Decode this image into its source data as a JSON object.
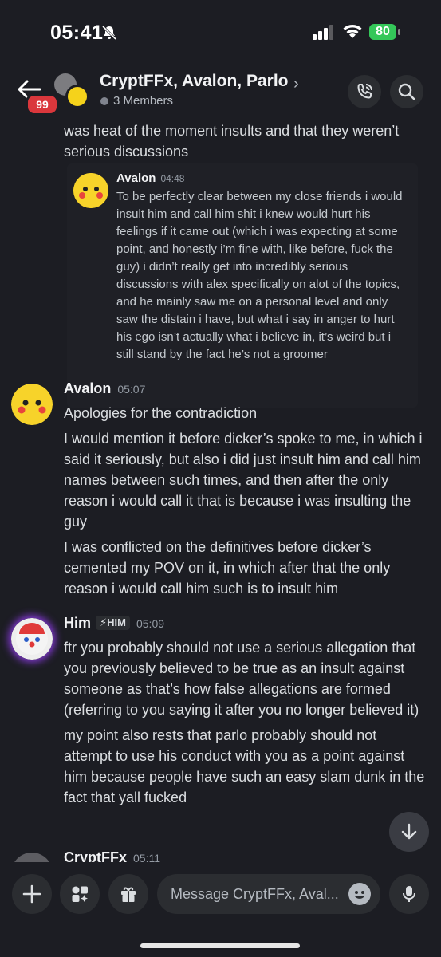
{
  "status": {
    "time": "05:41",
    "battery": "80"
  },
  "header": {
    "unread_badge": "99",
    "title": "CryptFFx, Avalon, Parlo",
    "members": "3 Members",
    "title_chevron": "›"
  },
  "continued": {
    "text": "was heat of the moment insults and that they weren’t serious discussions",
    "quote": {
      "author": "Avalon",
      "time": "04:48",
      "text": "To be perfectly clear between my close friends i would insult him and call him shit i knew would hurt his feelings if it came out (which i was expecting at some point, and honestly i’m fine with, like before, fuck the guy) i didn’t really get into incredibly serious discussions with alex specifically on alot of the topics, and he mainly saw me on a personal level and only saw the distain i have, but what i say in anger to hurt his ego isn’t actually what i believe in, it’s weird but i still stand by the fact he’s not a groomer"
    }
  },
  "messages": [
    {
      "author": "Avalon",
      "time": "05:07",
      "paragraphs": [
        "Apologies for the contradiction",
        "I would mention it before dicker’s spoke to me, in which i said it seriously, but also i did just insult him and call him names between such times, and then after the only reason i would call it that is because i was insulting the guy",
        "I was conflicted on the definitives before dicker’s cemented my POV on it, in which after that the only reason i would call him such is to insult him"
      ]
    },
    {
      "author": "Him",
      "tag": "⚡HIM",
      "time": "05:09",
      "paragraphs": [
        "ftr you probably should not use a serious allegation that you previously believed to be true as an insult against someone as that’s how false allegations are formed (referring to you saying it after you no longer believed it)",
        "my point also rests that parlo probably should not attempt to use his conduct with you as a point against him because people have such an easy slam dunk in the fact that yall fucked"
      ]
    },
    {
      "author": "CryptFFx",
      "time": "05:11"
    }
  ],
  "composer": {
    "placeholder": "Message CryptFFx, Aval..."
  },
  "icons": {
    "back": "back-arrow-icon",
    "call": "phone-call-icon",
    "search": "search-icon",
    "add": "plus-icon",
    "apps": "apps-icon",
    "gift": "gift-icon",
    "emoji": "emoji-icon",
    "mic": "microphone-icon",
    "scroll": "arrow-down-icon"
  },
  "colors": {
    "background": "#1c1d23",
    "badge": "#da373c",
    "battery": "#34c759"
  }
}
